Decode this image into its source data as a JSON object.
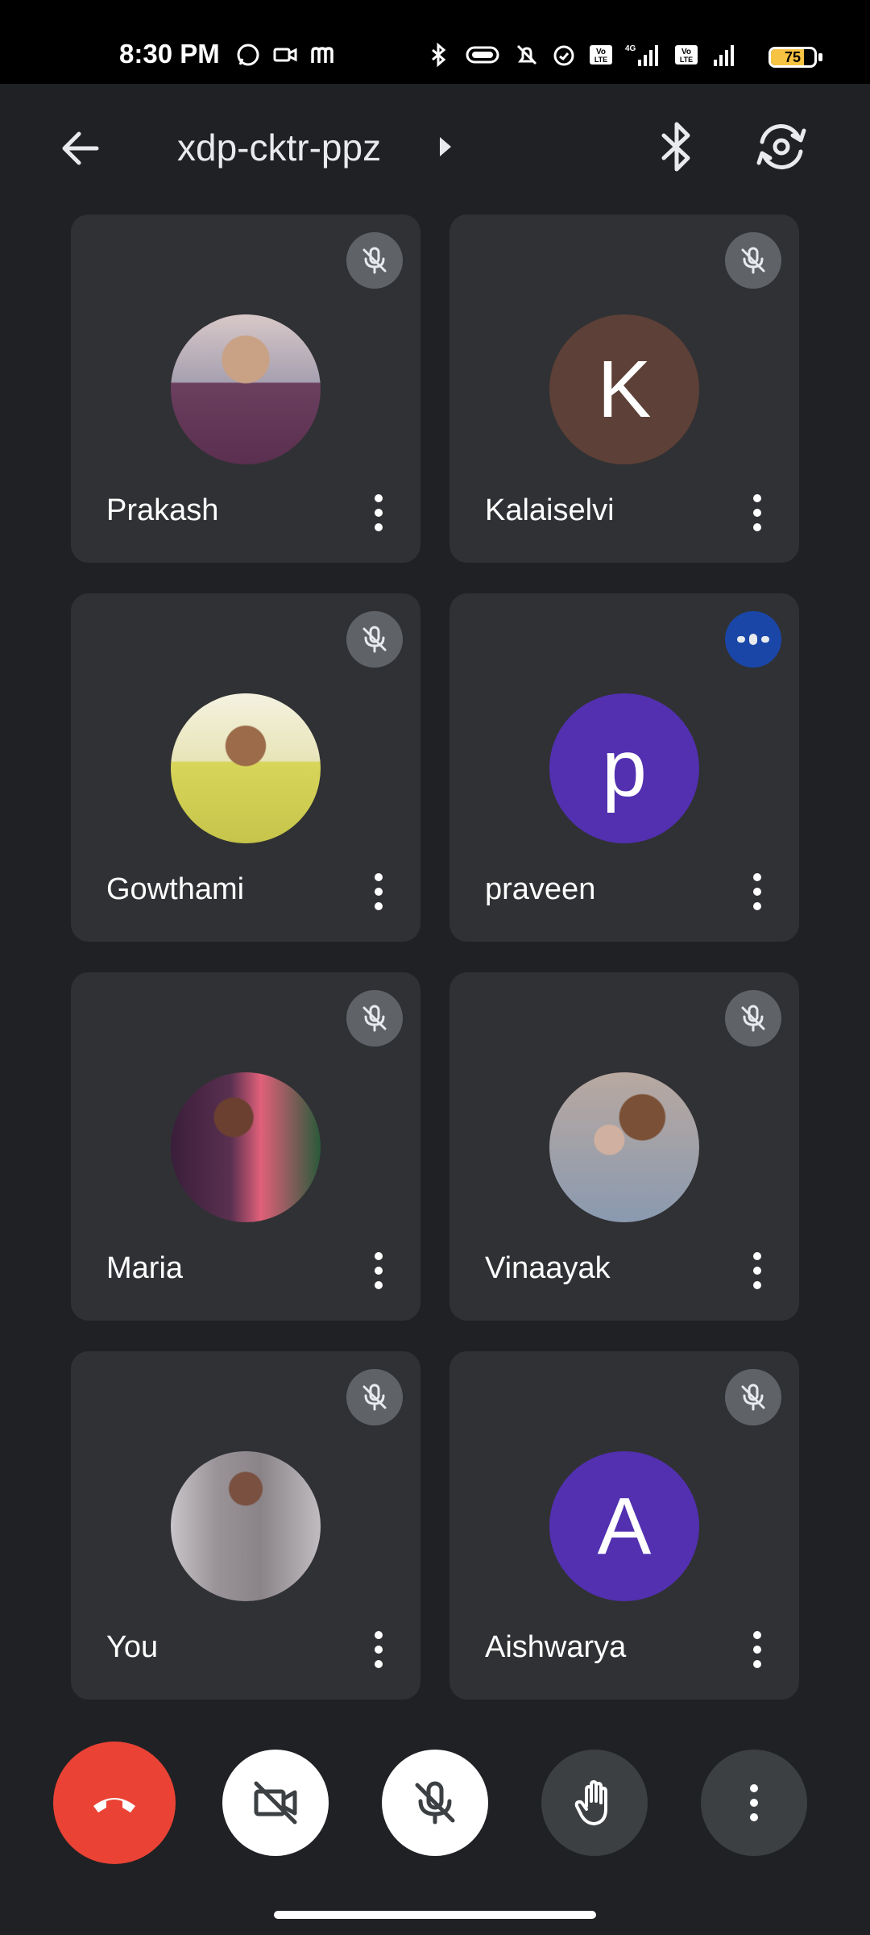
{
  "status_bar": {
    "time": "8:30 PM",
    "battery_level": "75",
    "battery_fraction": 0.75
  },
  "header": {
    "meeting_code": "xdp-cktr-ppz",
    "back_icon": "arrow-left-icon",
    "bluetooth_icon": "bluetooth-icon",
    "switch_camera_icon": "switch-camera-icon"
  },
  "participants": [
    {
      "name": "Prakash",
      "avatar_type": "photo",
      "status": "muted"
    },
    {
      "name": "Kalaiselvi",
      "avatar_type": "letter",
      "letter": "K",
      "avatar_color": "#5d4037",
      "status": "muted"
    },
    {
      "name": "Gowthami",
      "avatar_type": "photo",
      "status": "muted"
    },
    {
      "name": "praveen",
      "avatar_type": "letter",
      "letter": "p",
      "avatar_color": "#5230b0",
      "status": "speaking"
    },
    {
      "name": "Maria",
      "avatar_type": "photo",
      "status": "muted"
    },
    {
      "name": "Vinaayak",
      "avatar_type": "photo",
      "status": "muted"
    },
    {
      "name": "You",
      "avatar_type": "photo",
      "status": "muted"
    },
    {
      "name": "Aishwarya",
      "avatar_type": "letter",
      "letter": "A",
      "avatar_color": "#5230b0",
      "status": "muted"
    }
  ],
  "controls": {
    "end_call_icon": "end-call-icon",
    "camera_off_icon": "camera-off-icon",
    "mic_off_icon": "mic-off-icon",
    "raise_hand_icon": "raise-hand-icon",
    "more_options_icon": "more-vert-icon"
  },
  "colors": {
    "background": "#202124",
    "tile": "#303134",
    "end_call": "#ea4335",
    "speaking_badge": "#1a46a8"
  }
}
